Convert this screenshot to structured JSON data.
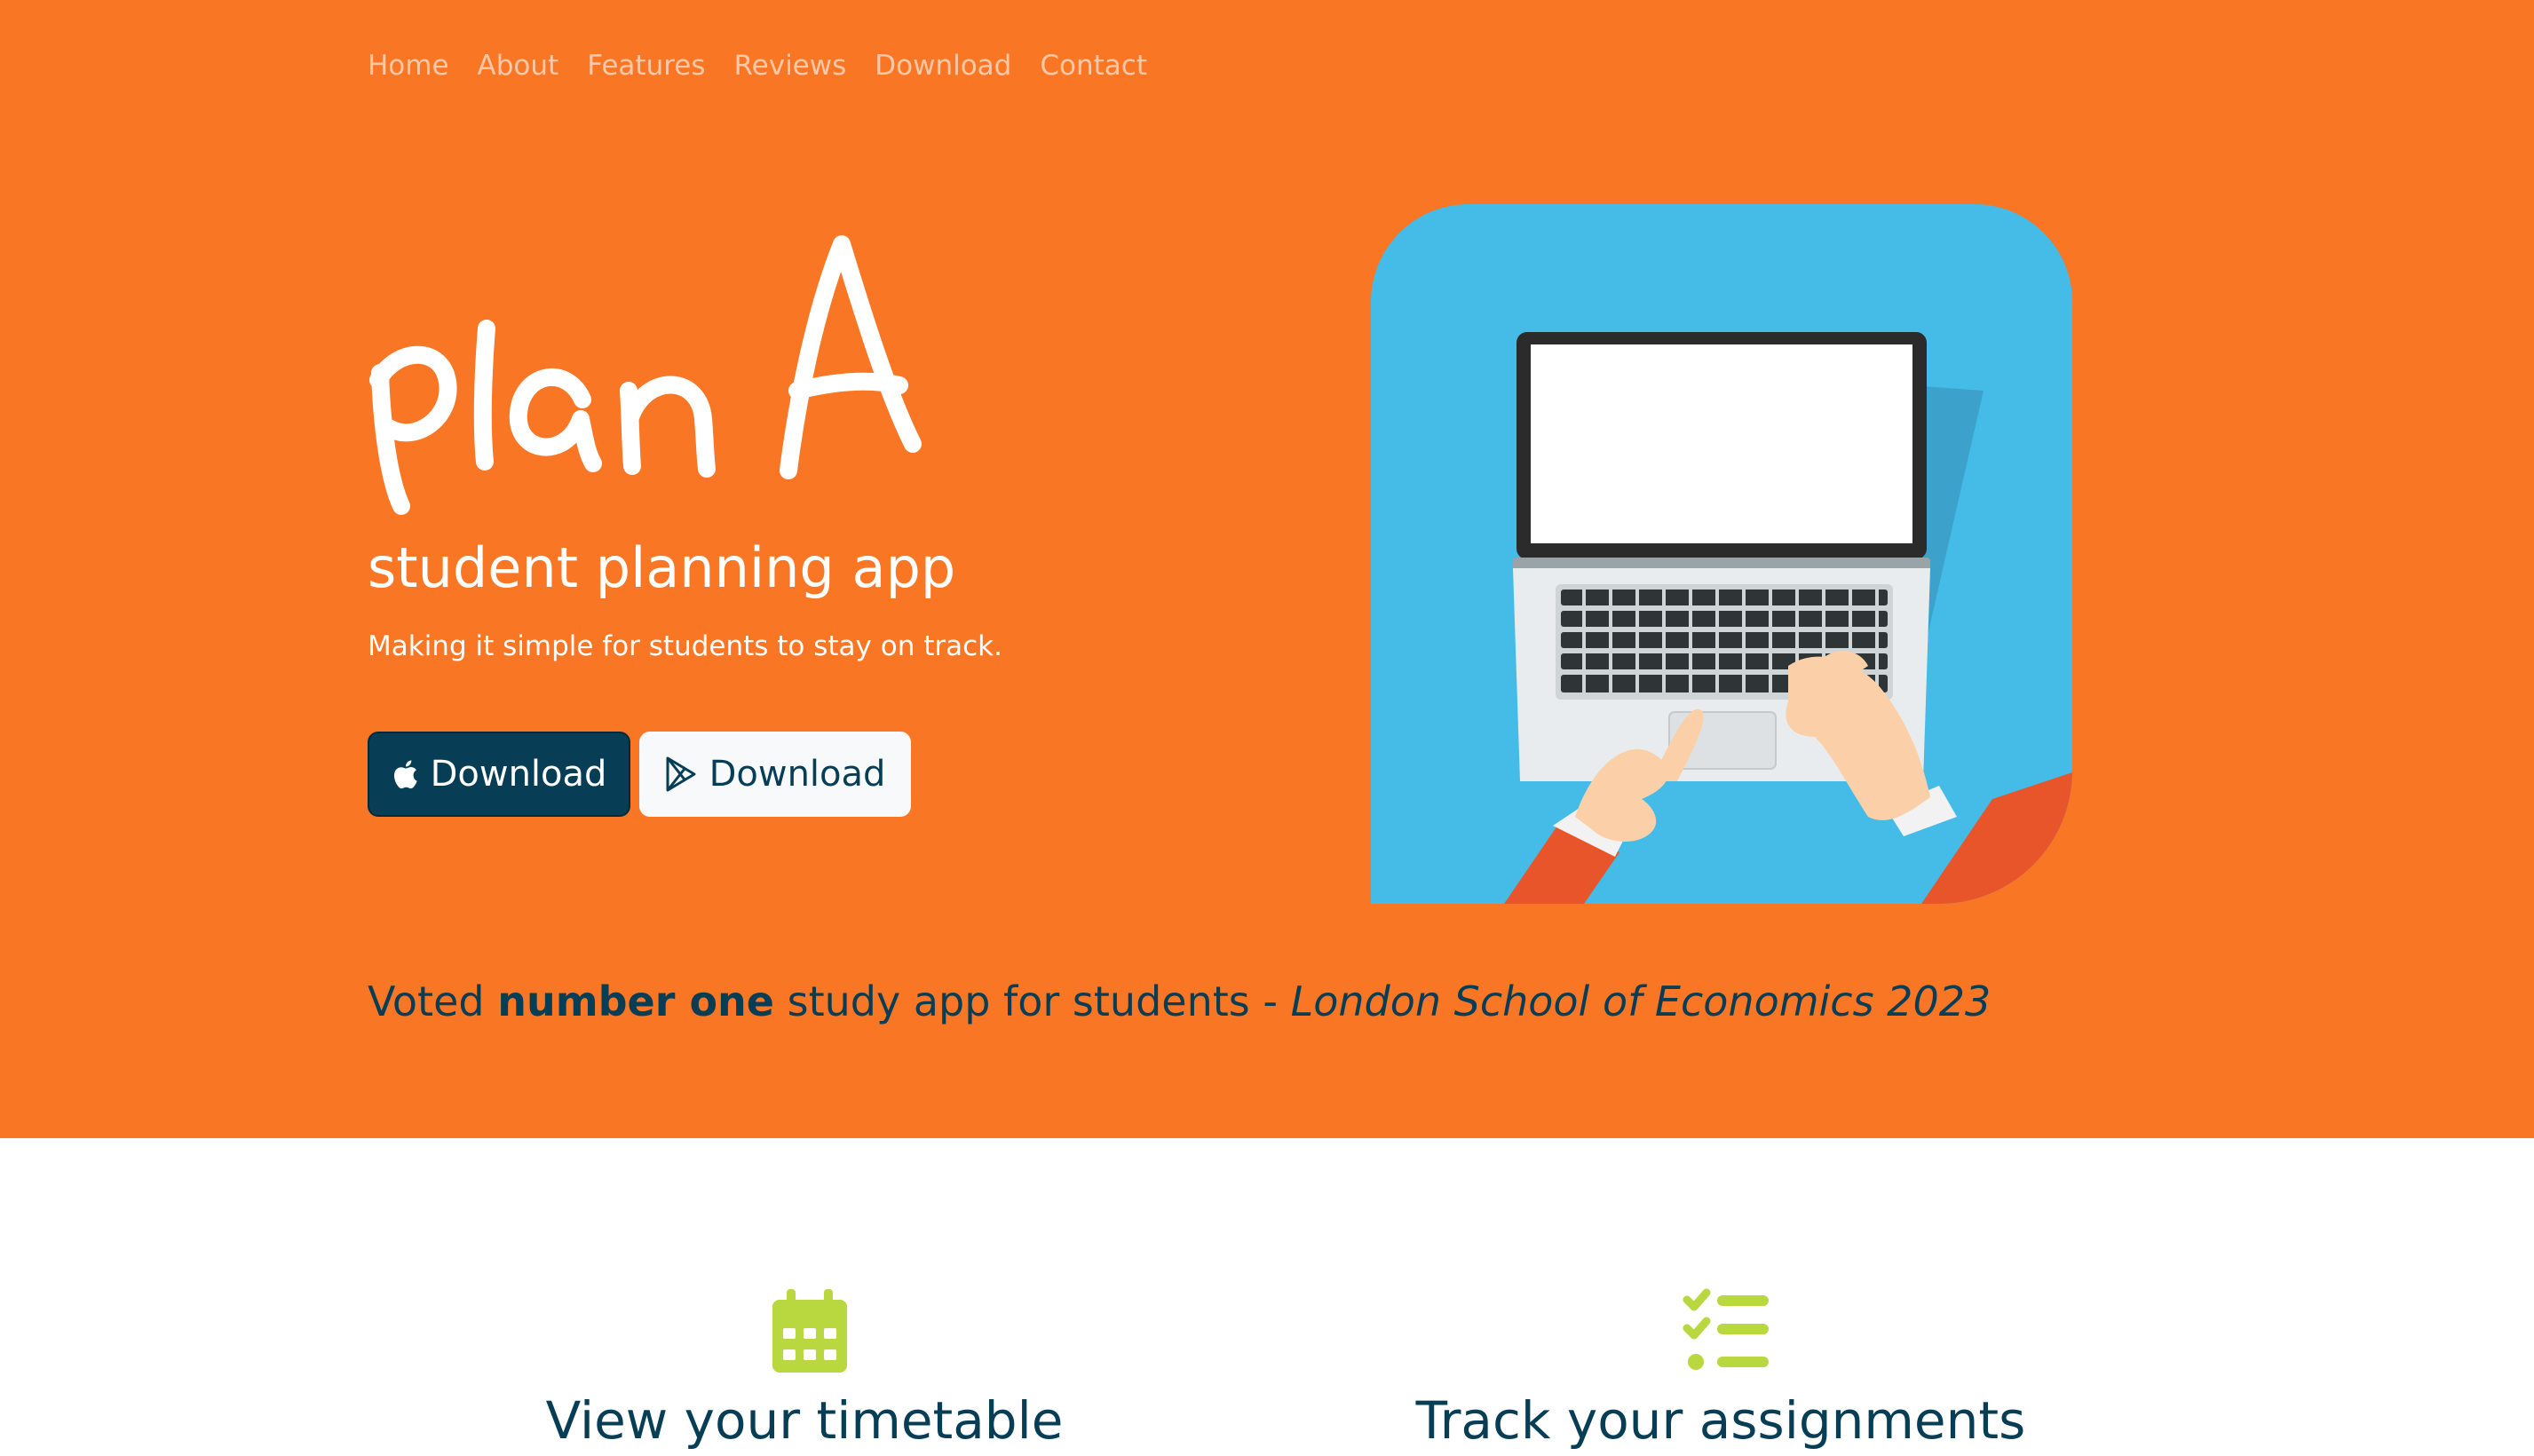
{
  "nav": {
    "items": [
      "Home",
      "About",
      "Features",
      "Reviews",
      "Download",
      "Contact"
    ]
  },
  "hero": {
    "logo_text": "plan A",
    "subtitle": "student planning app",
    "tagline": "Making it simple for students to stay on track.",
    "apple_button_label": "Download",
    "google_button_label": "Download",
    "illustration": "laptop-hands-illustration"
  },
  "quote": {
    "lead": "Voted ",
    "emphasis": "number one",
    "middle": " study app for students - ",
    "source": "London School of Economics 2023"
  },
  "features": [
    {
      "icon": "calendar-icon",
      "title": "View your timetable"
    },
    {
      "icon": "checklist-icon",
      "title": "Track your assignments"
    }
  ],
  "colors": {
    "hero_bg": "#f97625",
    "dark_blue": "#073e56",
    "accent_green": "#b9d840",
    "illustration_bg": "#45bbe8"
  }
}
